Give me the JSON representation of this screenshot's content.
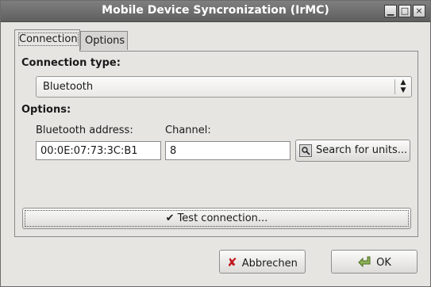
{
  "window": {
    "title": "Mobile Device Syncronization (IrMC)",
    "controls": [
      "minimize-icon",
      "maximize-icon",
      "close-icon"
    ]
  },
  "tabs": [
    {
      "label": "Connection",
      "active": true
    },
    {
      "label": "Options",
      "active": false
    }
  ],
  "connection": {
    "type_heading": "Connection type:",
    "type_value": "Bluetooth",
    "options_heading": "Options:",
    "address_label": "Bluetooth address:",
    "address_value": "00:0E:07:73:3C:B1",
    "channel_label": "Channel:",
    "channel_value": "8",
    "search_button": "Search for units...",
    "test_button": "Test connection..."
  },
  "footer": {
    "cancel": "Abbrechen",
    "ok": "OK"
  },
  "colors": {
    "titlebar": "#6f6f6f",
    "window_bg": "#e6e5e2",
    "cancel_icon": "#c0181c",
    "ok_icon": "#6a8c3a"
  }
}
